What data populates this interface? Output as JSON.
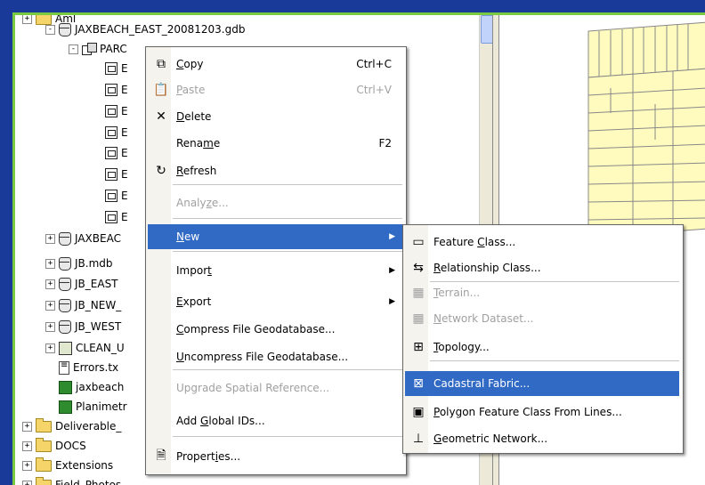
{
  "tree": [
    {
      "label": "Aml",
      "indent": 0,
      "exp": "+",
      "icon": "folder-icon"
    },
    {
      "label": "JAXBEACH_EAST_20081203.gdb",
      "indent": 1,
      "exp": "-",
      "icon": "database-icon"
    },
    {
      "label": "PARC",
      "indent": 2,
      "exp": "-",
      "icon": "feature-dataset-icon"
    },
    {
      "label": "E",
      "indent": 3,
      "exp": "",
      "icon": "feature-class-icon"
    },
    {
      "label": "E",
      "indent": 3,
      "exp": "",
      "icon": "feature-class-icon"
    },
    {
      "label": "E",
      "indent": 3,
      "exp": "",
      "icon": "feature-class-icon"
    },
    {
      "label": "E",
      "indent": 3,
      "exp": "",
      "icon": "feature-class-icon"
    },
    {
      "label": "E",
      "indent": 3,
      "exp": "",
      "icon": "feature-class-icon"
    },
    {
      "label": "E",
      "indent": 3,
      "exp": "",
      "icon": "feature-class-icon"
    },
    {
      "label": "E",
      "indent": 3,
      "exp": "",
      "icon": "feature-class-icon"
    },
    {
      "label": "E",
      "indent": 3,
      "exp": "",
      "icon": "feature-class-icon"
    },
    {
      "label": "JAXBEAC",
      "indent": 1,
      "exp": "+",
      "icon": "database-icon"
    },
    {
      "label": "JB.mdb",
      "indent": 1,
      "exp": "+",
      "icon": "database-icon"
    },
    {
      "label": "JB_EAST",
      "indent": 1,
      "exp": "+",
      "icon": "database-icon"
    },
    {
      "label": "JB_NEW_",
      "indent": 1,
      "exp": "+",
      "icon": "database-icon"
    },
    {
      "label": "JB_WEST",
      "indent": 1,
      "exp": "+",
      "icon": "database-icon"
    },
    {
      "label": "CLEAN_U",
      "indent": 1,
      "exp": "+",
      "icon": "topology-icon"
    },
    {
      "label": "Errors.tx",
      "indent": 1,
      "exp": "",
      "icon": "text-file-icon"
    },
    {
      "label": "jaxbeach",
      "indent": 1,
      "exp": "",
      "icon": "layer-icon"
    },
    {
      "label": "Planimetr",
      "indent": 1,
      "exp": "",
      "icon": "layer-icon"
    },
    {
      "label": "Deliverable_",
      "indent": 0,
      "exp": "+",
      "icon": "folder-icon"
    },
    {
      "label": "DOCS",
      "indent": 0,
      "exp": "+",
      "icon": "folder-icon"
    },
    {
      "label": "Extensions",
      "indent": 0,
      "exp": "+",
      "icon": "folder-icon"
    },
    {
      "label": "Field_Photos",
      "indent": 0,
      "exp": "+",
      "icon": "folder-icon"
    }
  ],
  "context_menu": {
    "items": [
      {
        "label": "Copy",
        "u": "C",
        "pre": "",
        "post": "opy",
        "shortcut": "Ctrl+C",
        "icon": "copy-icon",
        "glyph": "⧉",
        "disabled": false
      },
      {
        "label": "Paste",
        "pre": "",
        "u": "P",
        "post": "aste",
        "shortcut": "Ctrl+V",
        "icon": "paste-icon",
        "glyph": "📋",
        "disabled": true
      },
      {
        "label": "Delete",
        "pre": "",
        "u": "D",
        "post": "elete",
        "shortcut": "",
        "icon": "delete-icon",
        "glyph": "✕",
        "disabled": false
      },
      {
        "label": "Rename",
        "pre": "Rena",
        "u": "m",
        "post": "e",
        "shortcut": "F2",
        "icon": "",
        "glyph": "",
        "disabled": false
      },
      {
        "label": "Refresh",
        "pre": "",
        "u": "R",
        "post": "efresh",
        "shortcut": "",
        "icon": "refresh-icon",
        "glyph": "↻",
        "disabled": false
      },
      {
        "label": "Analyze...",
        "pre": "Analy",
        "u": "z",
        "post": "e...",
        "shortcut": "",
        "icon": "",
        "glyph": "",
        "disabled": true
      },
      {
        "label": "New",
        "pre": "",
        "u": "N",
        "post": "ew",
        "shortcut": "",
        "icon": "",
        "glyph": "",
        "disabled": false,
        "selected": true,
        "submenu": true
      },
      {
        "label": "Import",
        "pre": "Impor",
        "u": "t",
        "post": "",
        "shortcut": "",
        "icon": "",
        "glyph": "",
        "disabled": false,
        "submenu": true
      },
      {
        "label": "Export",
        "pre": "",
        "u": "E",
        "post": "xport",
        "shortcut": "",
        "icon": "",
        "glyph": "",
        "disabled": false,
        "submenu": true
      },
      {
        "label": "Compress File Geodatabase...",
        "pre": "",
        "u": "C",
        "post": "ompress File Geodatabase...",
        "shortcut": "",
        "icon": "",
        "glyph": "",
        "disabled": false
      },
      {
        "label": "Uncompress File Geodatabase...",
        "pre": "",
        "u": "U",
        "post": "ncompress File Geodatabase...",
        "shortcut": "",
        "icon": "",
        "glyph": "",
        "disabled": false
      },
      {
        "label": "Upgrade Spatial Reference...",
        "pre": "Upgrade Spatial Reference...",
        "u": "",
        "post": "",
        "shortcut": "",
        "icon": "",
        "glyph": "",
        "disabled": true
      },
      {
        "label": "Add Global IDs...",
        "pre": "Add ",
        "u": "G",
        "post": "lobal IDs...",
        "shortcut": "",
        "icon": "",
        "glyph": "",
        "disabled": false
      },
      {
        "label": "Properties...",
        "pre": "Propert",
        "u": "i",
        "post": "es...",
        "shortcut": "",
        "icon": "properties-icon",
        "glyph": "🗎",
        "disabled": false
      }
    ]
  },
  "submenu": {
    "items": [
      {
        "label": "Feature Class...",
        "pre": "Feature ",
        "u": "C",
        "post": "lass...",
        "icon": "feature-class-icon",
        "glyph": "▭",
        "disabled": false
      },
      {
        "label": "Relationship Class...",
        "pre": "",
        "u": "R",
        "post": "elationship Class...",
        "icon": "relationship-class-icon",
        "glyph": "⇆",
        "disabled": false
      },
      {
        "label": "Terrain...",
        "pre": "",
        "u": "T",
        "post": "errain...",
        "icon": "terrain-icon",
        "glyph": "▦",
        "disabled": true
      },
      {
        "label": "Network Dataset...",
        "pre": "",
        "u": "N",
        "post": "etwork Dataset...",
        "icon": "network-dataset-icon",
        "glyph": "▦",
        "disabled": true
      },
      {
        "label": "Topology...",
        "pre": "",
        "u": "T",
        "post": "opology...",
        "icon": "topology-icon",
        "glyph": "⊞",
        "disabled": false
      },
      {
        "label": "Cadastral Fabric...",
        "pre": "Cadastral Fabric...",
        "u": "",
        "post": "",
        "icon": "cadastral-fabric-icon",
        "glyph": "⊠",
        "disabled": false,
        "selected": true
      },
      {
        "label": "Polygon Feature Class From Lines...",
        "pre": "",
        "u": "P",
        "post": "olygon Feature Class From Lines...",
        "icon": "polygon-icon",
        "glyph": "▣",
        "disabled": false
      },
      {
        "label": "Geometric Network...",
        "pre": "",
        "u": "G",
        "post": "eometric Network...",
        "icon": "geometric-network-icon",
        "glyph": "⊥",
        "disabled": false
      }
    ]
  },
  "colors": {
    "frame_border": "#7ac943",
    "background": "#1a3a9a",
    "selection": "#316ac5",
    "parcel_fill": "#fffbbf"
  }
}
